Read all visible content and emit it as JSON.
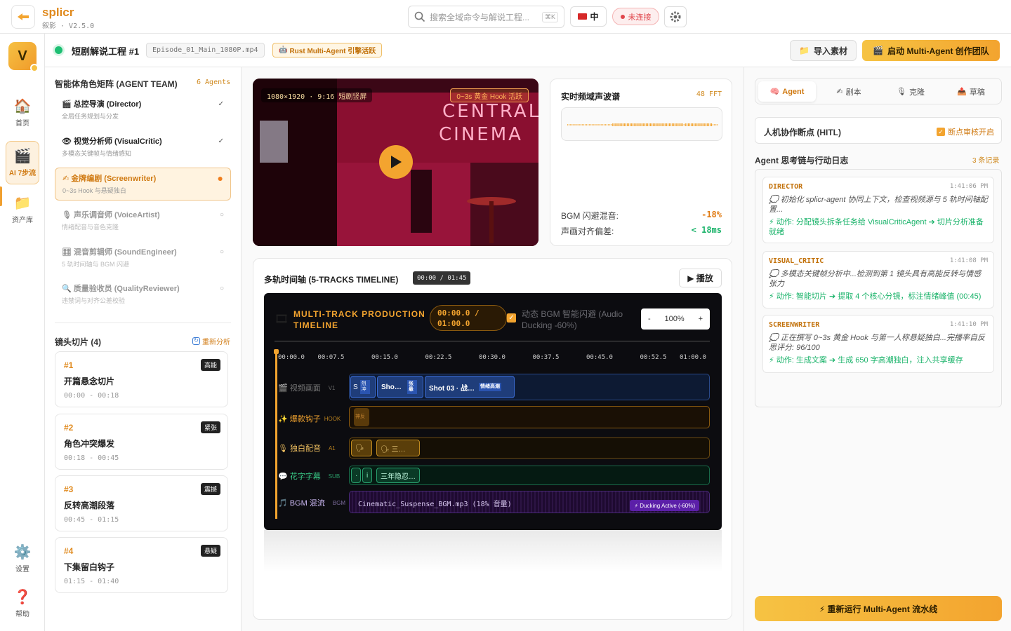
{
  "app": {
    "brand": "splicr",
    "subtitle": "叙影 · V2.5.0"
  },
  "topbar": {
    "search_placeholder": "搜索全域命令与解说工程...",
    "search_kbd": "⌘K",
    "lang_label": "中",
    "status_label": "未连接"
  },
  "sidebar": {
    "avatar_initial": "V",
    "items": [
      {
        "label": "首页",
        "icon": "🏠"
      },
      {
        "label": "AI 7步流",
        "icon": "🎬"
      },
      {
        "label": "资产库",
        "icon": "📁"
      },
      {
        "label": "设置",
        "icon": "⚙️"
      },
      {
        "label": "帮助",
        "icon": "❓"
      }
    ]
  },
  "project": {
    "title": "短剧解说工程",
    "number": "#1",
    "file": "Episode_01_Main_1080P.mp4",
    "engine_chip": "Rust Multi-Agent 引擎活跃",
    "import_label": "导入素材",
    "launch_label": "启动 Multi-Agent 创作团队"
  },
  "agents": {
    "title": "智能体角色矩阵 (AGENT TEAM)",
    "count": "6 Agents",
    "items": [
      {
        "icon": "🎬",
        "name": "总控导演 (Director)",
        "desc": "全局任务规划与分发",
        "status": "✓"
      },
      {
        "icon": "👁",
        "name": "视觉分析师 (VisualCritic)",
        "desc": "多模态关键帧与情绪感知",
        "status": "✓"
      },
      {
        "icon": "✍",
        "name": "金牌编剧 (Screenwriter)",
        "desc": "0~3s Hook 与悬疑独白",
        "status": "●"
      },
      {
        "icon": "🎙",
        "name": "声乐调音师 (VoiceArtist)",
        "desc": "情绪配音与音色克隆",
        "status": "○"
      },
      {
        "icon": "🎛",
        "name": "混音剪辑师 (SoundEngineer)",
        "desc": "5 轨时间轴与 BGM 闪避",
        "status": "○"
      },
      {
        "icon": "🔍",
        "name": "质量验收员 (QualityReviewer)",
        "desc": "违禁词与对齐公差校验",
        "status": "○"
      }
    ]
  },
  "shots": {
    "title": "镜头切片 (4)",
    "reanalyze": "重新分析",
    "items": [
      {
        "no": "#1",
        "title": "开篇悬念切片",
        "time": "00:00 - 00:18",
        "tag": "高能"
      },
      {
        "no": "#2",
        "title": "角色冲突爆发",
        "time": "00:18 - 00:45",
        "tag": "紧张"
      },
      {
        "no": "#3",
        "title": "反转高潮段落",
        "time": "00:45 - 01:15",
        "tag": "震撼"
      },
      {
        "no": "#4",
        "title": "下集留白钩子",
        "time": "01:15 - 01:40",
        "tag": "悬疑"
      }
    ]
  },
  "video": {
    "format_chip": "1080×1920 · 9:16 短剧竖屏",
    "hook_chip": "0~3s 黄金 Hook 活跃"
  },
  "waveform": {
    "title": "实时频域声波谱",
    "fft": "48 FFT",
    "bgm_label": "BGM 闪避混音:",
    "bgm_value": "-18%",
    "align_label": "声画对齐偏差:",
    "align_value": "< 18ms"
  },
  "timeline": {
    "title": "多轨时间轴 (5-TRACKS TIMELINE)",
    "time_chip": "00:00 / 01:45",
    "play_label": "▶ 播放",
    "header_title": "MULTI-TRACK PRODUCTION TIMELINE",
    "clock": "00:00.0 / 01:00.0",
    "ducking": "动态 BGM 智能闪避 (Audio Ducking -60%)",
    "zoom_minus": "-",
    "zoom_value": "100%",
    "zoom_plus": "+",
    "ticks": [
      "00:00.0",
      "00:07.5",
      "00:15.0",
      "00:22.5",
      "00:30.0",
      "00:37.5",
      "00:45.0",
      "00:52.5",
      "01:00.0"
    ],
    "tracks": [
      {
        "icon": "🎬",
        "name": "视频画面",
        "code": "V1"
      },
      {
        "icon": "✨",
        "name": "爆款钩子",
        "code": "HOOK"
      },
      {
        "icon": "🎙",
        "name": "独白配音",
        "code": "A1"
      },
      {
        "icon": "💬",
        "name": "花字字幕",
        "code": "SUB"
      },
      {
        "icon": "🎵",
        "name": "BGM 混流",
        "code": "BGM"
      }
    ],
    "video_clips": [
      {
        "label": "S",
        "tag": "烈冲"
      },
      {
        "label": "Sho…",
        "tag": "张悬"
      },
      {
        "label": "Shot 03 · 战…",
        "tag": "情绪高潮"
      }
    ],
    "hook_clip": "神反",
    "voice_clips": [
      "🗣",
      "🗣 三…"
    ],
    "sub_clips": [
      "·",
      "i",
      "三年隐忍…"
    ],
    "bgm_file": "Cinematic_Suspense_BGM.mp3 (18% 音量)",
    "bgm_ducking": "⚡ Ducking Active (-60%)"
  },
  "right": {
    "tabs": [
      {
        "icon": "🧠",
        "label": "Agent"
      },
      {
        "icon": "✍",
        "label": "剧本"
      },
      {
        "icon": "🎙",
        "label": "克隆"
      },
      {
        "icon": "📤",
        "label": "草稿"
      }
    ],
    "hitl_title": "人机协作断点 (HITL)",
    "hitl_check": "断点审核开启",
    "log_title": "Agent 思考链与行动日志",
    "log_count": "3 条记录",
    "logs": [
      {
        "who": "DIRECTOR",
        "time": "1:41:06 PM",
        "msg": "💭 初始化 splicr-agent 协同上下文，检查视频源与 5 轨时间轴配置...",
        "act": "⚡ 动作: 分配镜头拆条任务给 VisualCriticAgent ➔ 切片分析准备就绪"
      },
      {
        "who": "VISUAL_CRITIC",
        "time": "1:41:08 PM",
        "msg": "💭 多模态关键帧分析中...检测到第 1 镜头具有高能反转与情感张力",
        "act": "⚡ 动作: 智能切片 ➔ 提取 4 个核心分镜，标注情绪峰值 (00:45)"
      },
      {
        "who": "SCREENWRITER",
        "time": "1:41:10 PM",
        "msg": "💭 正在撰写 0~3s 黄金 Hook 与第一人称悬疑独白...完播率自反思评分: 96/100",
        "act": "⚡ 动作: 生成文案 ➔ 生成 650 字高潮独白，注入共享缓存"
      }
    ],
    "rerun_label": "⚡ 重新运行 Multi-Agent 流水线"
  },
  "colors": {
    "accent": "#f3a42f",
    "brand": "#e08a1e",
    "success": "#1ab36a",
    "danger": "#e0454b"
  }
}
